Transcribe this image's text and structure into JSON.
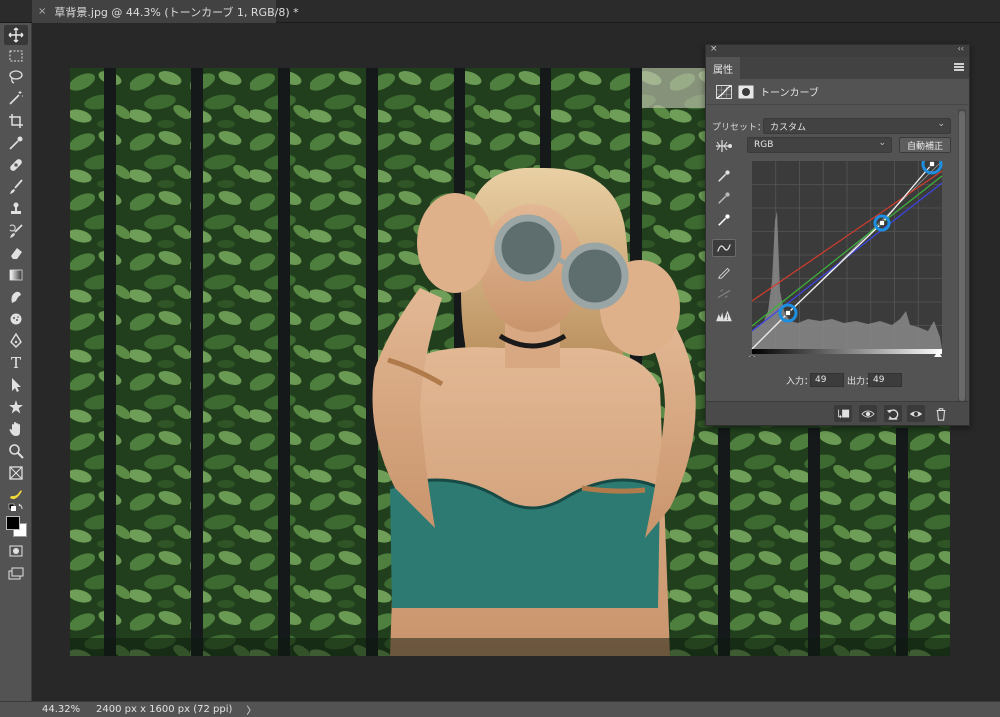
{
  "document": {
    "tab_title": "草背景.jpg @ 44.3% (トーンカーブ 1, RGB/8) *",
    "close_glyph": "×"
  },
  "toolbar": {
    "tools": [
      "move-tool",
      "marquee-tool",
      "lasso-tool",
      "magic-wand-tool",
      "crop-tool",
      "eyedropper-tool",
      "healing-brush-tool",
      "brush-tool",
      "clone-stamp-tool",
      "history-brush-tool",
      "eraser-tool",
      "gradient-tool",
      "blur-tool",
      "dodge-tool",
      "pen-tool",
      "type-tool",
      "path-selection-tool",
      "shape-tool",
      "hand-tool",
      "zoom-tool",
      "frame-tool",
      "banana-extra-tool",
      "default-colors",
      "foreground-background-colors",
      "quick-mask",
      "screen-mode"
    ],
    "type_glyph": "T",
    "colors": {
      "foreground": "#000000",
      "background": "#ffffff"
    }
  },
  "status": {
    "zoom": "44.32%",
    "dimensions": "2400 px x 1600 px (72 ppi)",
    "arrow": "〉"
  },
  "properties_panel": {
    "tab_label": "属性",
    "close_glyph": "×",
    "collapse_glyph": "‹‹",
    "adjustment_name": "トーンカーブ",
    "preset_label": "プリセット：",
    "preset_value": "カスタム",
    "channel_value": "RGB",
    "auto_button": "自動補正",
    "input_label": "入力：",
    "input_value": "49",
    "output_label": "出力：",
    "output_value": "49",
    "chevron": "⌄"
  },
  "colors": {
    "panel_bg": "#535353",
    "highlight_ring": "#1e8fe0",
    "curve_red": "#d23c2c",
    "curve_green": "#3cb43c",
    "curve_blue": "#3c46e6"
  }
}
